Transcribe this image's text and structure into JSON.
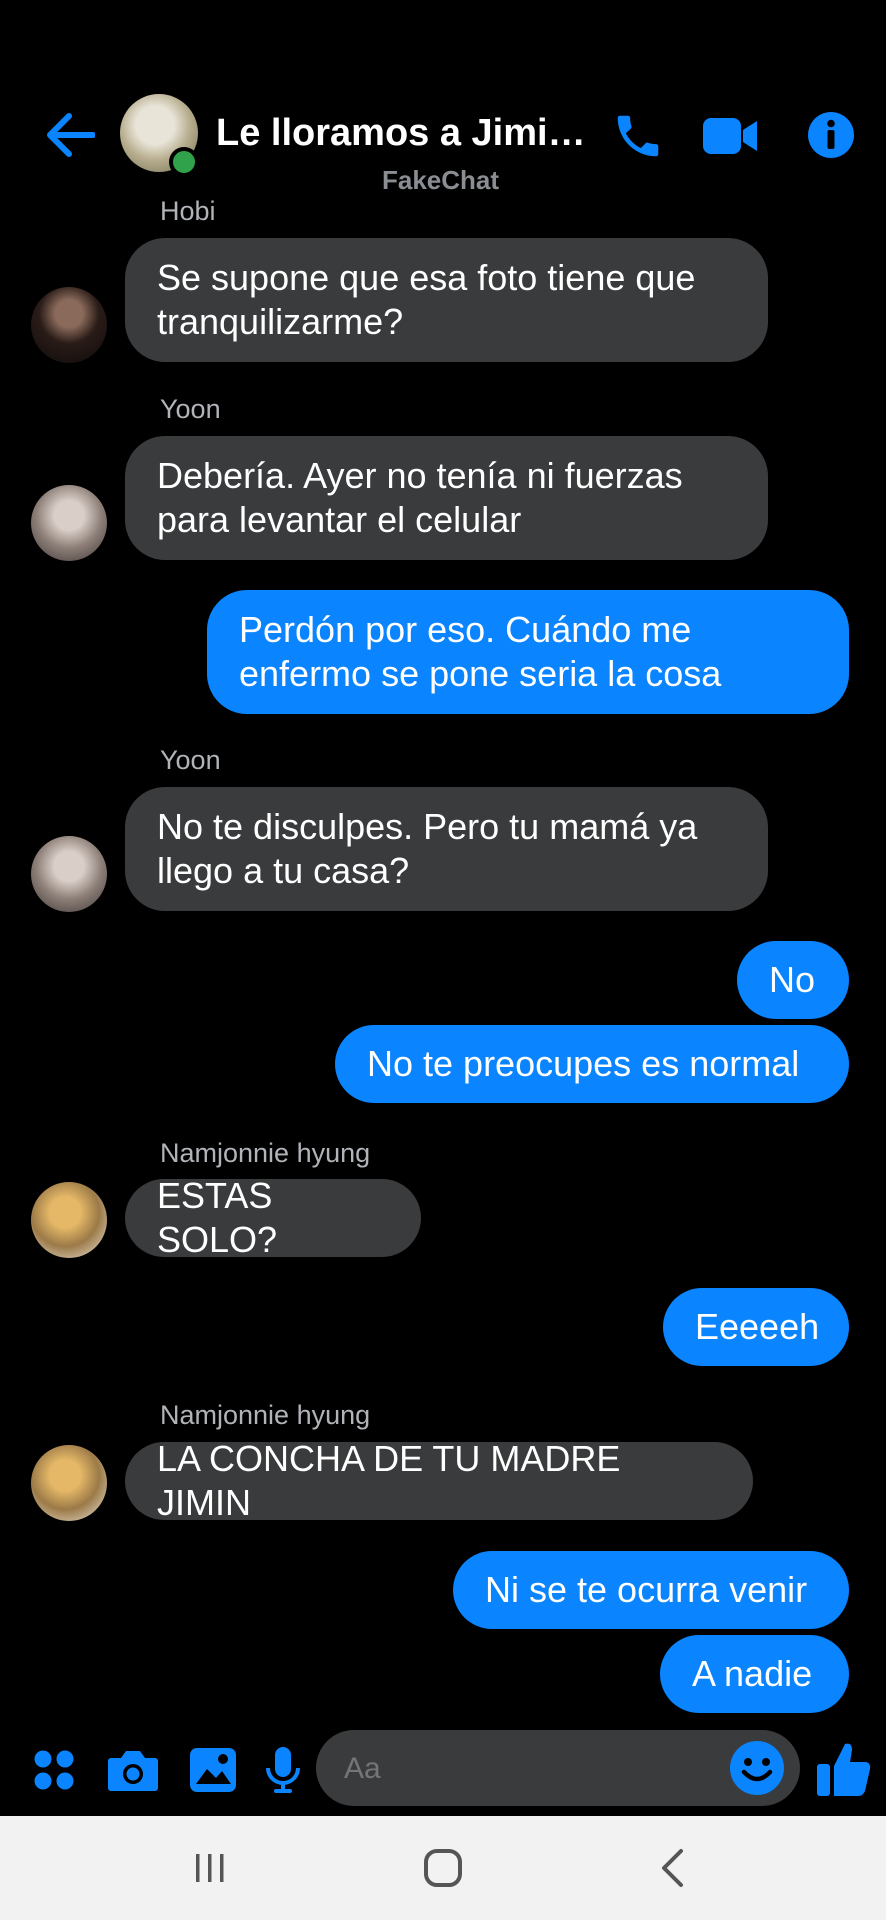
{
  "header": {
    "title": "Le lloramos a Jimi…",
    "watermark": "FakeChat",
    "online_color": "#31a24c",
    "accent": "#0a84ff",
    "icons": [
      "back-arrow-icon",
      "phone-icon",
      "video-camera-icon",
      "info-icon"
    ]
  },
  "messages": [
    {
      "direction": "in",
      "sender": "Hobi",
      "text": "Se supone que esa foto tiene que\ntranquilizarme?"
    },
    {
      "direction": "in",
      "sender": "Yoon",
      "text": "Debería. Ayer no tenía ni fuerzas\npara levantar el celular"
    },
    {
      "direction": "out",
      "text": "Perdón por eso. Cuándo me\nenfermo se pone seria la cosa"
    },
    {
      "direction": "in",
      "sender": "Yoon",
      "text": "No te disculpes. Pero tu mamá ya\nllego a tu casa?"
    },
    {
      "direction": "out",
      "text": "No"
    },
    {
      "direction": "out",
      "text": "No te preocupes es normal"
    },
    {
      "direction": "in",
      "sender": "Namjonnie hyung",
      "text": "ESTAS SOLO?"
    },
    {
      "direction": "out",
      "text": "Eeeeeh"
    },
    {
      "direction": "in",
      "sender": "Namjonnie hyung",
      "text": "LA CONCHA DE TU MADRE JIMIN"
    },
    {
      "direction": "out",
      "text": "Ni se te ocurra venir"
    },
    {
      "direction": "out",
      "text": "A nadie"
    }
  ],
  "composer": {
    "placeholder": "Aa",
    "icons": [
      "apps-grid-icon",
      "camera-icon",
      "gallery-icon",
      "microphone-icon",
      "emoji-icon",
      "like-thumb-icon"
    ]
  },
  "navbar": {
    "icons": [
      "recent-apps-icon",
      "home-icon",
      "back-icon"
    ]
  }
}
